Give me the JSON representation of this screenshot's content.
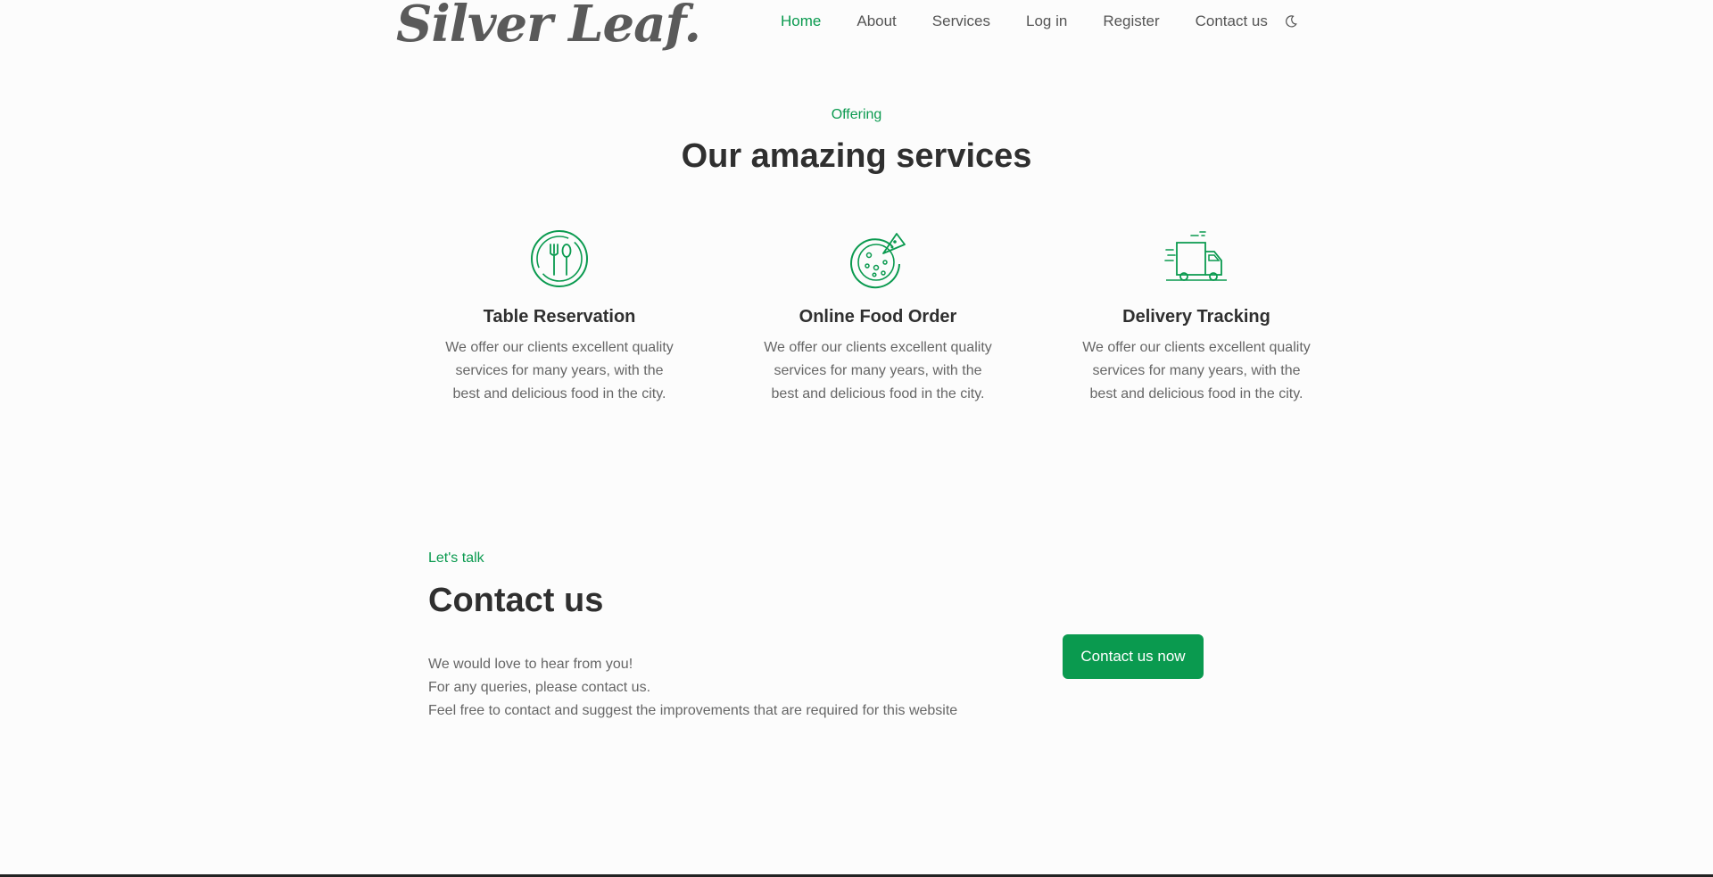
{
  "header": {
    "brand": "Silver Leaf.",
    "nav": [
      "Home",
      "About",
      "Services",
      "Log in",
      "Register",
      "Contact us"
    ],
    "active_index": 0,
    "theme_icon": "moon-icon"
  },
  "services_section": {
    "eyebrow": "Offering",
    "title": "Our amazing services",
    "items": [
      {
        "icon": "plate-cutlery-icon",
        "title": "Table Reservation",
        "text": "We offer our clients excellent quality services for many years, with the best and delicious food in the city."
      },
      {
        "icon": "pizza-icon",
        "title": "Online Food Order",
        "text": "We offer our clients excellent quality services for many years, with the best and delicious food in the city."
      },
      {
        "icon": "delivery-truck-icon",
        "title": "Delivery Tracking",
        "text": "We offer our clients excellent quality services for many years, with the best and delicious food in the city."
      }
    ]
  },
  "contact_section": {
    "eyebrow": "Let's talk",
    "title": "Contact us",
    "lines": [
      "We would love to hear from you!",
      "For any queries, please contact us.",
      "Feel free to contact and suggest the improvements that are required for this website"
    ],
    "button": "Contact us now"
  },
  "colors": {
    "accent": "#0a9a4f",
    "heading": "#2f2f2f",
    "text": "#666666",
    "brand": "#5a5a5a"
  }
}
